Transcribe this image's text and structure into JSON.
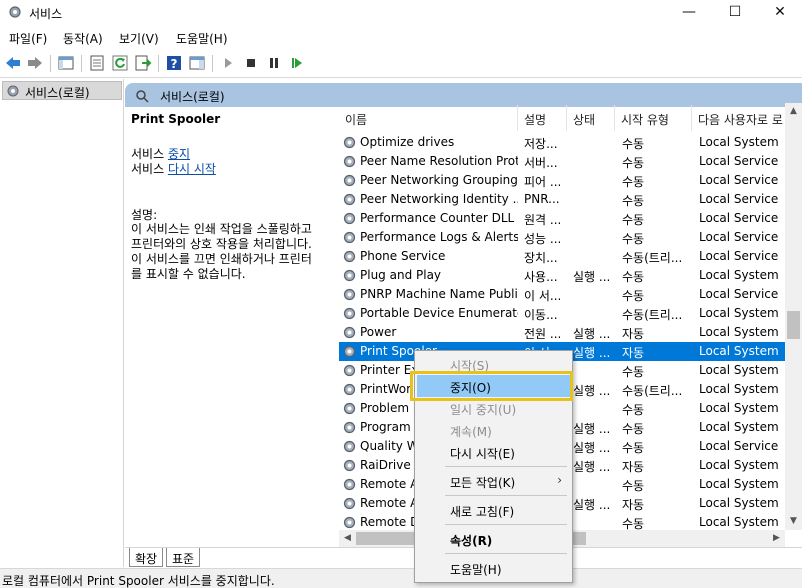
{
  "window": {
    "title": "서비스",
    "minimize": "—",
    "maximize": "☐",
    "close": "✕"
  },
  "menu": [
    "파일(F)",
    "동작(A)",
    "보기(V)",
    "도움말(H)"
  ],
  "toolbar": {
    "icons": [
      "back-arrow-icon",
      "forward-arrow-icon",
      "show-hide-tree-icon",
      "properties-icon",
      "refresh-icon",
      "export-list-icon",
      "help-icon",
      "show-hide-action-pane-icon",
      "start-service-icon",
      "stop-service-icon",
      "pause-service-icon",
      "restart-service-icon"
    ]
  },
  "tree": {
    "root_label": "서비스(로컬)"
  },
  "content_header": {
    "label": "서비스(로컬)"
  },
  "details": {
    "service_name": "Print Spooler",
    "line1_prefix": "서비스 ",
    "line1_link": "중지",
    "line2_prefix": "서비스 ",
    "line2_link": "다시 시작",
    "desc_label": "설명:",
    "desc_lines": [
      "이 서비스는 인쇄 작업을 스풀링하고",
      "프린터와의 상호 작용을 처리합니다.",
      "이 서비스를 끄면 인쇄하거나 프린터",
      "를 표시할 수 없습니다."
    ]
  },
  "columns": [
    "이름",
    "설명",
    "상태",
    "시작 유형",
    "다음 사용자로 로"
  ],
  "services": [
    {
      "name": "Optimize drives",
      "desc": "저장...",
      "status": "",
      "start": "수동",
      "logon": "Local System"
    },
    {
      "name": "Peer Name Resolution Prot...",
      "desc": "서버...",
      "status": "",
      "start": "수동",
      "logon": "Local Service"
    },
    {
      "name": "Peer Networking Grouping",
      "desc": "피어 ...",
      "status": "",
      "start": "수동",
      "logon": "Local Service"
    },
    {
      "name": "Peer Networking Identity ...",
      "desc": "PNR...",
      "status": "",
      "start": "수동",
      "logon": "Local Service"
    },
    {
      "name": "Performance Counter DLL ...",
      "desc": "원격 ...",
      "status": "",
      "start": "수동",
      "logon": "Local Service"
    },
    {
      "name": "Performance Logs & Alerts",
      "desc": "성능 ...",
      "status": "",
      "start": "수동",
      "logon": "Local Service"
    },
    {
      "name": "Phone Service",
      "desc": "장치...",
      "status": "",
      "start": "수동(트리...",
      "logon": "Local Service"
    },
    {
      "name": "Plug and Play",
      "desc": "사용...",
      "status": "실행 ...",
      "start": "수동",
      "logon": "Local System"
    },
    {
      "name": "PNRP Machine Name Publi...",
      "desc": "이 서...",
      "status": "",
      "start": "수동",
      "logon": "Local Service"
    },
    {
      "name": "Portable Device Enumerato...",
      "desc": "이동...",
      "status": "",
      "start": "수동(트리...",
      "logon": "Local System"
    },
    {
      "name": "Power",
      "desc": "전원 ...",
      "status": "실행 ...",
      "start": "자동",
      "logon": "Local System"
    },
    {
      "name": "Print Spooler",
      "desc": "이 서...",
      "status": "실행 ...",
      "start": "자동",
      "logon": "Local System",
      "selected": true
    },
    {
      "name": "Printer Ext",
      "desc": "",
      "status": "",
      "start": "수동",
      "logon": "Local System"
    },
    {
      "name": "PrintWor",
      "desc": "",
      "status": "실행 ...",
      "start": "수동(트리...",
      "logon": "Local System"
    },
    {
      "name": "Problem R",
      "desc": "",
      "status": "",
      "start": "수동",
      "logon": "Local System"
    },
    {
      "name": "Program C",
      "desc": "",
      "status": "실행 ...",
      "start": "수동",
      "logon": "Local System"
    },
    {
      "name": "Quality W",
      "desc": "",
      "status": "실행 ...",
      "start": "수동",
      "logon": "Local Service"
    },
    {
      "name": "RaiDrive F",
      "desc": "",
      "status": "실행 ...",
      "start": "자동",
      "logon": "Local System"
    },
    {
      "name": "Remote A",
      "desc": "",
      "status": "",
      "start": "수동",
      "logon": "Local System"
    },
    {
      "name": "Remote A",
      "desc": "",
      "status": "실행 ...",
      "start": "자동",
      "logon": "Local System"
    },
    {
      "name": "Remote D",
      "desc": "",
      "status": "",
      "start": "수동",
      "logon": "Local System"
    }
  ],
  "tabs": [
    "확장",
    "표준"
  ],
  "status_bar": "로컬 컴퓨터에서 Print Spooler 서비스를 중지합니다.",
  "context_menu": [
    {
      "label": "시작(S)",
      "disabled": true
    },
    {
      "label": "중지(O)",
      "highlighted": true
    },
    {
      "label": "일시 중지(U)",
      "disabled": true
    },
    {
      "label": "계속(M)",
      "disabled": true
    },
    {
      "label": "다시 시작(E)"
    },
    {
      "separator": true
    },
    {
      "label": "모든 작업(K)",
      "submenu": "›"
    },
    {
      "separator": true
    },
    {
      "label": "새로 고침(F)"
    },
    {
      "separator": true
    },
    {
      "label": "속성(R)",
      "bold": true
    },
    {
      "separator": true
    },
    {
      "label": "도움말(H)"
    }
  ],
  "colors": {
    "selection": "#0078d7",
    "header_band": "#a9c4e0",
    "menu_highlight": "#91c9f7",
    "callout_border": "#e6c21a",
    "link": "#0b4fa8"
  }
}
